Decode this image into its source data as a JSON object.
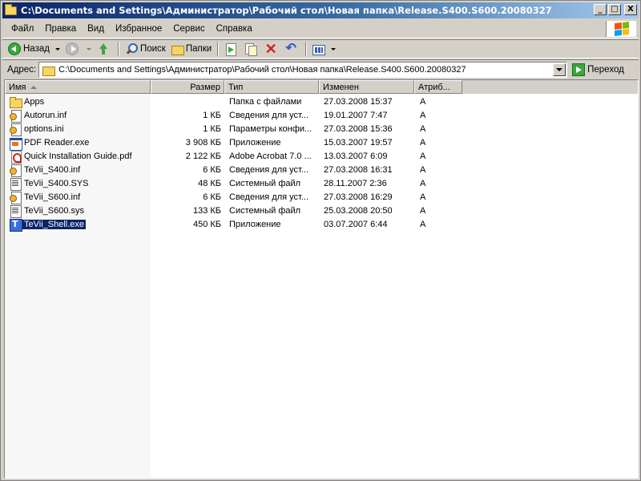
{
  "window": {
    "title": "C:\\Documents and Settings\\Администратор\\Рабочий стол\\Новая папка\\Release.S400.S600.20080327",
    "minimize_label": "_",
    "maximize_label": "□",
    "close_label": "X"
  },
  "menu": [
    "Файл",
    "Правка",
    "Вид",
    "Избранное",
    "Сервис",
    "Справка"
  ],
  "toolbar": {
    "back_label": "Назад",
    "search_label": "Поиск",
    "folders_label": "Папки"
  },
  "address": {
    "label": "Адрес:",
    "value": "C:\\Documents and Settings\\Администратор\\Рабочий стол\\Новая папка\\Release.S400.S600.20080327",
    "go_label": "Переход"
  },
  "columns": {
    "name": "Имя",
    "size": "Размер",
    "type": "Тип",
    "modified": "Изменен",
    "attributes": "Атриб..."
  },
  "files": [
    {
      "name": "Apps",
      "size": "",
      "type": "Папка с файлами",
      "modified": "27.03.2008 15:37",
      "attributes": "A",
      "icon": "folder-icon"
    },
    {
      "name": "Autorun.inf",
      "size": "1 КБ",
      "type": "Сведения для уст...",
      "modified": "19.01.2007 7:47",
      "attributes": "A",
      "icon": "inf-file-icon"
    },
    {
      "name": "options.ini",
      "size": "1 КБ",
      "type": "Параметры конфи...",
      "modified": "27.03.2008 15:36",
      "attributes": "A",
      "icon": "ini-file-icon"
    },
    {
      "name": "PDF Reader.exe",
      "size": "3 908 КБ",
      "type": "Приложение",
      "modified": "15.03.2007 19:57",
      "attributes": "A",
      "icon": "exe-file-icon"
    },
    {
      "name": "Quick Installation Guide.pdf",
      "size": "2 122 КБ",
      "type": "Adobe Acrobat 7.0 ...",
      "modified": "13.03.2007 6:09",
      "attributes": "A",
      "icon": "pdf-file-icon"
    },
    {
      "name": "TeVii_S400.inf",
      "size": "6 КБ",
      "type": "Сведения для уст...",
      "modified": "27.03.2008 16:31",
      "attributes": "A",
      "icon": "inf-file-icon"
    },
    {
      "name": "TeVii_S400.SYS",
      "size": "48 КБ",
      "type": "Системный файл",
      "modified": "28.11.2007 2:36",
      "attributes": "A",
      "icon": "sys-file-icon"
    },
    {
      "name": "TeVii_S600.inf",
      "size": "6 КБ",
      "type": "Сведения для уст...",
      "modified": "27.03.2008 16:29",
      "attributes": "A",
      "icon": "inf-file-icon"
    },
    {
      "name": "TeVii_S600.sys",
      "size": "133 КБ",
      "type": "Системный файл",
      "modified": "25.03.2008 20:50",
      "attributes": "A",
      "icon": "sys-file-icon"
    },
    {
      "name": "TeVii_Shell.exe",
      "size": "450 КБ",
      "type": "Приложение",
      "modified": "03.07.2007 6:44",
      "attributes": "A",
      "icon": "tevii-app-icon",
      "selected": true
    }
  ],
  "colors": {
    "titlebar_start": "#0a246a",
    "titlebar_end": "#a6caf0",
    "selection": "#0a246a",
    "face": "#d4d0c8"
  }
}
